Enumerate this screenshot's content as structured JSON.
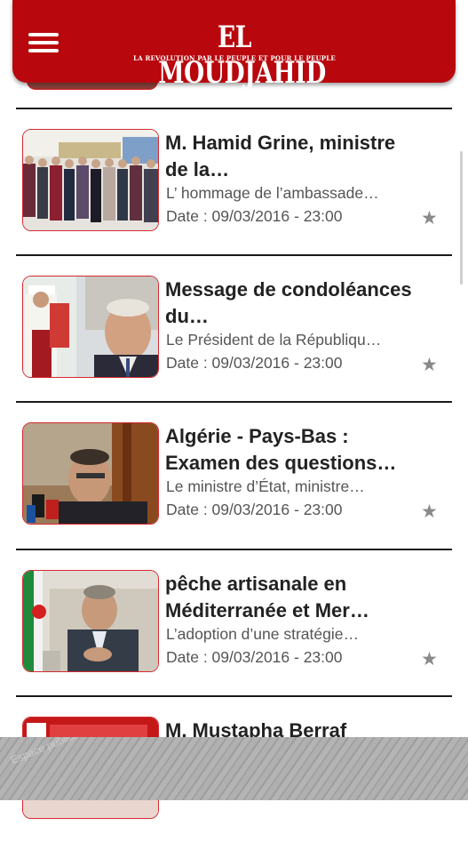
{
  "header": {
    "title": "EL MOUDJAHID",
    "subtitle": "LA REVOLUTION PAR LE PEUPLE ET POUR LE PEUPLE",
    "menu_icon": "hamburger-menu-icon",
    "brand_color": "#b8070d"
  },
  "articles": [
    {
      "title": "M. Hamid Grine, ministre de la…",
      "excerpt": "L’ hommage de l’ambassade…",
      "date": "Date : 09/03/2016 - 23:00",
      "favorite_icon": "star-icon"
    },
    {
      "title": "Message de condoléances du…",
      "excerpt": "Le Président de la Républiqu…",
      "date": "Date : 09/03/2016 - 23:00",
      "favorite_icon": "star-icon"
    },
    {
      "title": "Algérie - Pays-Bas : Examen des questions…",
      "excerpt": "Le ministre d’État, ministre…",
      "date": "Date : 09/03/2016 - 23:00",
      "favorite_icon": "star-icon"
    },
    {
      "title": "pêche artisanale en Méditerranée et Mer…",
      "excerpt": "L’adoption d’une stratégie…",
      "date": "Date : 09/03/2016 - 23:00",
      "favorite_icon": "star-icon"
    },
    {
      "title": "M. Mustapha Berraf"
    }
  ],
  "ad": {
    "label": "Espace publicitaire"
  }
}
